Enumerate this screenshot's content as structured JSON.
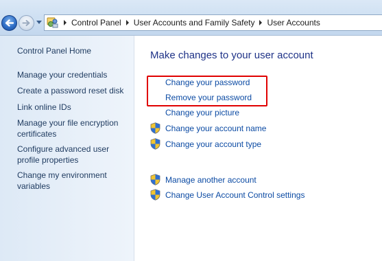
{
  "window": {
    "title": "User Accounts"
  },
  "nav": {
    "back_icon": "back-arrow-icon",
    "forward_icon": "forward-arrow-icon",
    "history_icon": "dropdown-arrow-icon"
  },
  "breadcrumb": {
    "icon": "control-panel-icon",
    "items": [
      "Control Panel",
      "User Accounts and Family Safety",
      "User Accounts"
    ]
  },
  "sidebar": {
    "home": "Control Panel Home",
    "items": [
      "Manage your credentials",
      "Create a password reset disk",
      "Link online IDs",
      "Manage your file encryption certificates",
      "Configure advanced user profile properties",
      "Change my environment variables"
    ]
  },
  "main": {
    "heading": "Make changes to your user account",
    "tasks": [
      {
        "label": "Change your password",
        "icon": ""
      },
      {
        "label": "Remove your password",
        "icon": ""
      },
      {
        "label": "Change your picture",
        "icon": ""
      },
      {
        "label": "Change your account name",
        "icon": "uac-shield-icon"
      },
      {
        "label": "Change your account type",
        "icon": "uac-shield-icon"
      }
    ],
    "other_tasks": [
      {
        "label": "Manage another account",
        "icon": "uac-shield-icon"
      },
      {
        "label": "Change User Account Control settings",
        "icon": "uac-shield-icon"
      }
    ]
  },
  "colors": {
    "link": "#0b4aa3",
    "heading": "#1e3287",
    "sidebar_link": "#1e3a5f",
    "highlight": "#e00000",
    "toolbar": "#cddff2"
  }
}
